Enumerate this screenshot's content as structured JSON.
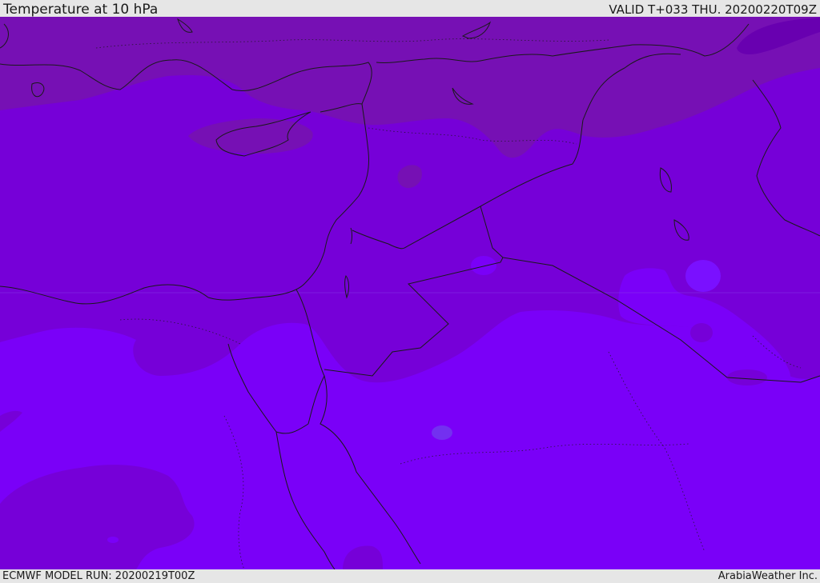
{
  "header": {
    "title": "Temperature at 10 hPa",
    "valid": "VALID T+033 THU. 20200220T09Z"
  },
  "footer": {
    "model_run": "ECMWF MODEL RUN: 20200219T00Z",
    "credit": "ArabiaWeather Inc."
  },
  "map": {
    "region": "Eastern Mediterranean and Middle East",
    "field_colors": {
      "coldest": "#6800b0",
      "cold": "#7610b4",
      "mid": "#7600d8",
      "warm": "#7a00f8",
      "warmest": "#7330f0"
    },
    "border_color": "#1a1a1a"
  }
}
